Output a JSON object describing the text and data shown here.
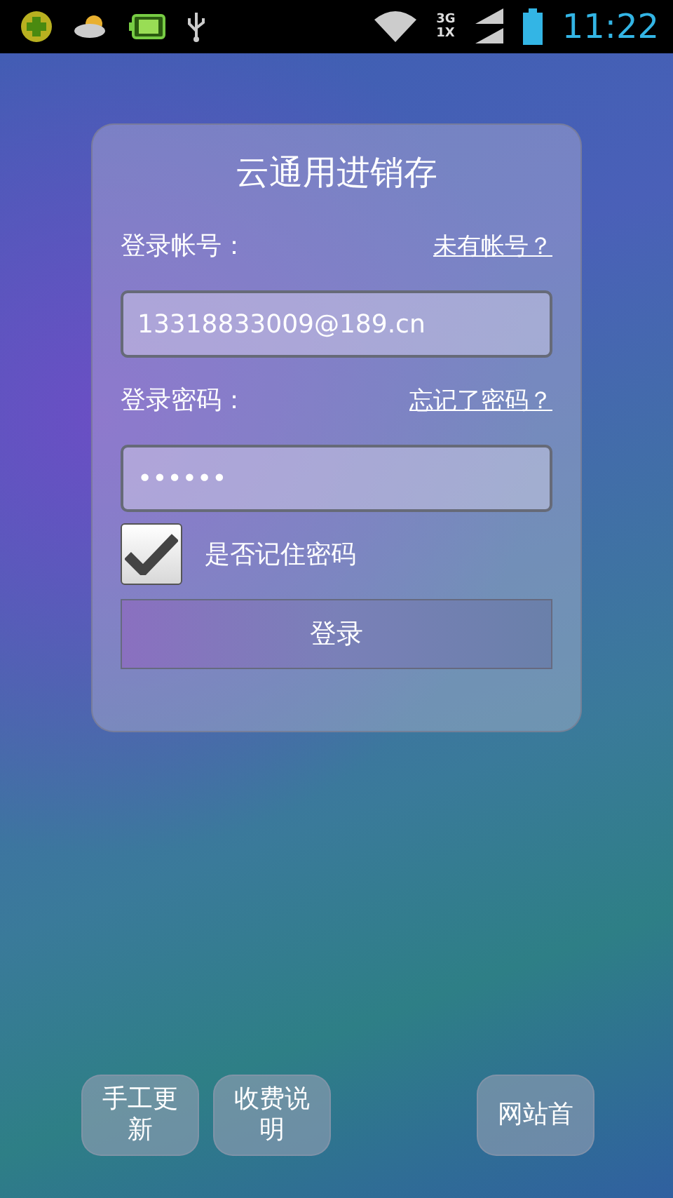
{
  "status_bar": {
    "network_labels": [
      "3G",
      "1X"
    ],
    "time": "11:22"
  },
  "login": {
    "title": "云通用进销存",
    "account_label": "登录帐号：",
    "register_link": "未有帐号？",
    "account_value": "13318833009@189.cn",
    "password_label": "登录密码：",
    "forgot_link": "忘记了密码？",
    "password_value": "••••••",
    "remember": {
      "label": "是否记住密码",
      "checked": true
    },
    "submit": "登录"
  },
  "bottom_buttons": [
    {
      "label": "手工更新"
    },
    {
      "label": "收费说明"
    },
    {
      "label": "网站首"
    }
  ]
}
